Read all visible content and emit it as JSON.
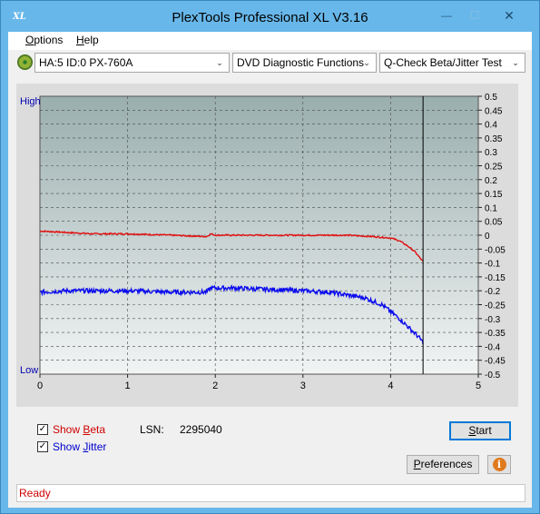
{
  "window": {
    "title": "PlexTools Professional XL V3.16",
    "icon_text": "XL",
    "minimize": "—",
    "maximize": "☐",
    "close": "✕"
  },
  "menu": {
    "items": [
      {
        "label": "Options",
        "mnemonic": "O"
      },
      {
        "label": "Help",
        "mnemonic": "H"
      }
    ]
  },
  "toolbar": {
    "drive": "HA:5 ID:0  PX-760A",
    "function": "DVD Diagnostic Functions",
    "test": "Q-Check Beta/Jitter Test",
    "arrow": "⌄"
  },
  "chart_data": {
    "type": "line",
    "xlim": [
      0,
      5
    ],
    "x_ticks": [
      "0",
      "1",
      "2",
      "3",
      "4",
      "5"
    ],
    "y_right_lim": [
      -0.5,
      0.5
    ],
    "y_right_ticks": [
      "0.5",
      "0.45",
      "0.4",
      "0.35",
      "0.3",
      "0.25",
      "0.2",
      "0.15",
      "0.1",
      "0.05",
      "0",
      "-0.05",
      "-0.1",
      "-0.15",
      "-0.2",
      "-0.25",
      "-0.3",
      "-0.35",
      "-0.4",
      "-0.45",
      "-0.5"
    ],
    "y_left_top_label": "High",
    "y_left_bottom_label": "Low",
    "end_marker_x": 4.37,
    "grid": true,
    "series": [
      {
        "name": "Beta",
        "color": "#e01010",
        "x": [
          0,
          0.3,
          0.6,
          1.0,
          1.5,
          1.9,
          1.95,
          2.0,
          2.5,
          3.0,
          3.3,
          3.5,
          3.8,
          4.0,
          4.1,
          4.2,
          4.28,
          4.33,
          4.37
        ],
        "y": [
          0.015,
          0.01,
          0.005,
          0.005,
          0.0,
          -0.005,
          0.005,
          0.0,
          0.0,
          0.0,
          0.0,
          0.0,
          -0.005,
          -0.01,
          -0.02,
          -0.04,
          -0.06,
          -0.08,
          -0.095
        ]
      },
      {
        "name": "Jitter",
        "color": "#0a0aee",
        "x": [
          0,
          0.3,
          0.6,
          1.0,
          1.5,
          1.9,
          1.95,
          2.2,
          2.6,
          3.0,
          3.3,
          3.5,
          3.7,
          3.9,
          4.0,
          4.1,
          4.2,
          4.3,
          4.37
        ],
        "y": [
          -0.205,
          -0.2,
          -0.2,
          -0.2,
          -0.205,
          -0.205,
          -0.19,
          -0.19,
          -0.195,
          -0.2,
          -0.205,
          -0.215,
          -0.225,
          -0.25,
          -0.275,
          -0.3,
          -0.33,
          -0.36,
          -0.385
        ]
      }
    ]
  },
  "controls": {
    "show_beta": {
      "label": "Show Beta",
      "checked": true,
      "mark": "✓"
    },
    "show_jitter": {
      "label": "Show Jitter",
      "checked": true,
      "mark": "✓"
    },
    "lsn_label": "LSN:",
    "lsn_value": "2295040",
    "start_label": "Start",
    "preferences_label": "Preferences",
    "info_symbol": "i"
  },
  "status": {
    "text": "Ready",
    "color": "#d00000"
  }
}
